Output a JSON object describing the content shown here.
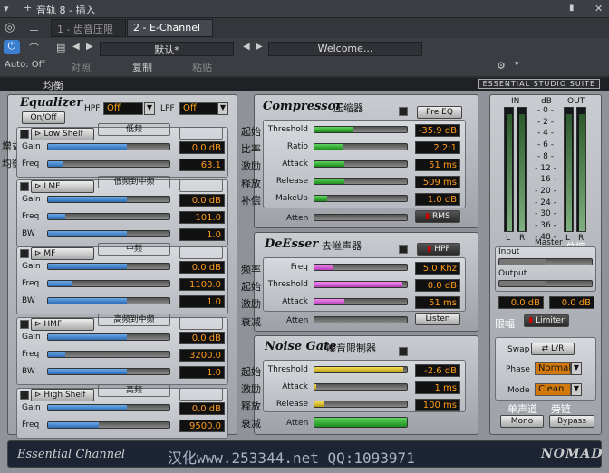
{
  "topbar": {
    "title": "音轨 8 - 插入"
  },
  "tabs": [
    {
      "label": "1 - 齿音压限器"
    },
    {
      "label": "2 - E-Channel"
    }
  ],
  "controls": {
    "auto_label": "Auto: Off",
    "preset": "默认*",
    "welcome": "Welcome...",
    "compare": "对照",
    "copy": "复制",
    "paste": "粘贴"
  },
  "brand": {
    "suite": "ESSENTIAL STUDIO SUITE"
  },
  "eq": {
    "title": "Equalizer",
    "title_cn": "均衡",
    "on_off": "On/Off",
    "hpf_label": "HPF",
    "hpf_value": "Off",
    "lpf_label": "LPF",
    "lpf_value": "Off",
    "side_cn1": "增益",
    "side_cn2": "均衡",
    "bands": [
      {
        "name": "Low Shelf",
        "icon": "low-shelf-icon",
        "cn": "低频",
        "rows": [
          {
            "label": "Gain",
            "value": "0.0 dB",
            "pos": 0.65
          },
          {
            "label": "Freq",
            "value": "63.1",
            "pos": 0.12
          }
        ]
      },
      {
        "name": "LMF",
        "cn": "低频到中频",
        "rows": [
          {
            "label": "Gain",
            "value": "0.0 dB",
            "pos": 0.65
          },
          {
            "label": "Freq",
            "value": "101.0",
            "pos": 0.14
          },
          {
            "label": "BW",
            "value": "1.0",
            "pos": 0.65
          }
        ]
      },
      {
        "name": "MF",
        "cn": "中频",
        "rows": [
          {
            "label": "Gain",
            "value": "0.0 dB",
            "pos": 0.65
          },
          {
            "label": "Freq",
            "value": "1100.0",
            "pos": 0.2
          },
          {
            "label": "BW",
            "value": "1.0",
            "pos": 0.65
          }
        ]
      },
      {
        "name": "HMF",
        "cn": "高频到中频",
        "rows": [
          {
            "label": "Gain",
            "value": "0.0 dB",
            "pos": 0.65
          },
          {
            "label": "Freq",
            "value": "3200.0",
            "pos": 0.14
          },
          {
            "label": "BW",
            "value": "1.0",
            "pos": 0.65
          }
        ]
      },
      {
        "name": "High Shelf",
        "cn": "高频",
        "rows": [
          {
            "label": "Gain",
            "value": "0.0 dB",
            "pos": 0.65
          },
          {
            "label": "Freq",
            "value": "9500.0",
            "pos": 0.42
          }
        ]
      }
    ]
  },
  "comp": {
    "title": "Compressor",
    "title_cn": "压缩器",
    "pre_eq": "Pre EQ",
    "atten": "Atten",
    "rms": "RMS",
    "rows": [
      {
        "cn": "起始",
        "label": "Threshold",
        "value": "-35.9 dB",
        "pos": 0.42
      },
      {
        "cn": "比率",
        "label": "Ratio",
        "value": "2.2:1",
        "pos": 0.3
      },
      {
        "cn": "激励",
        "label": "Attack",
        "value": "51 ms",
        "pos": 0.32
      },
      {
        "cn": "释放",
        "label": "Release",
        "value": "509 ms",
        "pos": 0.32
      },
      {
        "cn": "补偿",
        "label": "MakeUp",
        "value": "1.0 dB",
        "pos": 0.14
      }
    ]
  },
  "deesser": {
    "title": "DeEsser",
    "title_cn": "去咝声器",
    "hpf": "HPF",
    "atten": "Atten",
    "listen": "Listen",
    "rows": [
      {
        "cn": "频率",
        "label": "Freq",
        "value": "5.0 Khz",
        "pos": 0.2
      },
      {
        "cn": "起始",
        "label": "Threshold",
        "value": "0.0 dB",
        "pos": 0.95
      },
      {
        "cn": "激励",
        "label": "Attack",
        "value": "51 ms",
        "pos": 0.32
      }
    ],
    "atten_cn": "衰减"
  },
  "gate": {
    "title": "Noise Gate",
    "title_cn": "噪音限制器",
    "atten": "Atten",
    "rows": [
      {
        "cn": "起始",
        "label": "Threshold",
        "value": "-2.6 dB",
        "pos": 0.96
      },
      {
        "cn": "激励",
        "label": "Attack",
        "value": "1 ms",
        "pos": 0.02
      },
      {
        "cn": "释放",
        "label": "Release",
        "value": "100 ms",
        "pos": 0.1
      }
    ],
    "atten_cn": "衰减",
    "atten_level": 1.0
  },
  "master": {
    "in": "IN",
    "db": "dB",
    "out": "OUT",
    "scale": [
      "0",
      "2",
      "4",
      "6",
      "8",
      "12",
      "16",
      "20",
      "24",
      "30",
      "36",
      "48"
    ],
    "l": "L",
    "r": "R",
    "master": "Master",
    "master_cn": "总控",
    "input": "Input",
    "output": "Output",
    "input_value": "0.0 dB",
    "output_value": "0.0 dB",
    "input_pos": 0.5,
    "output_pos": 0.5,
    "limiter_cn": "限幅",
    "limiter": "Limiter",
    "swap": "Swap",
    "swap_value": "L/R",
    "phase": "Phase",
    "phase_value": "Normal",
    "mode": "Mode",
    "mode_value": "Clean",
    "mono_cn": "单声道",
    "bypass_cn": "旁链",
    "mono": "Mono",
    "bypass": "Bypass"
  },
  "footer": {
    "left": "Essential Channel",
    "mid": "汉化www.253344.net  QQ:1093971",
    "brand": "NOMAD"
  }
}
